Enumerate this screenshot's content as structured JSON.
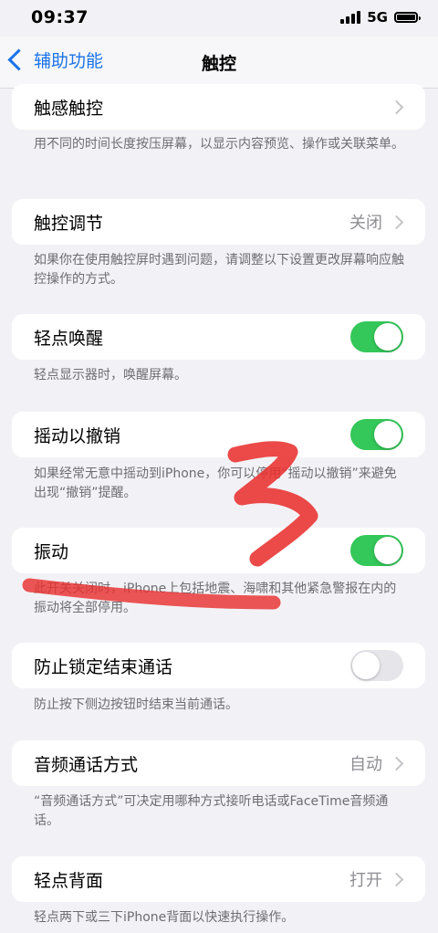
{
  "status_bar": {
    "time": "09:37",
    "network": "5G"
  },
  "nav": {
    "back_label": "辅助功能",
    "title": "触控"
  },
  "sections": [
    {
      "label": "触感触控",
      "value": "",
      "footnote": "用不同的时间长度按压屏幕，以显示内容预览、操作或关联菜单。"
    },
    {
      "label": "触控调节",
      "value": "关闭",
      "footnote": "如果你在使用触控屏时遇到问题，请调整以下设置更改屏幕响应触控操作的方式。"
    },
    {
      "label": "轻点唤醒",
      "toggle": true,
      "footnote": "轻点显示器时，唤醒屏幕。"
    },
    {
      "label": "摇动以撤销",
      "toggle": true,
      "footnote": "如果经常无意中摇动到iPhone，你可以停用“摇动以撤销”来避免出现“撤销”提醒。"
    },
    {
      "label": "振动",
      "toggle": true,
      "footnote": "此开关关闭时，iPhone上包括地震、海啸和其他紧急警报在内的振动将全部停用。"
    },
    {
      "label": "防止锁定结束通话",
      "toggle": false,
      "footnote": "防止按下侧边按钮时结束当前通话。"
    },
    {
      "label": "音频通话方式",
      "value": "自动",
      "footnote": "“音频通话方式”可决定用哪种方式接听电话或FaceTime音频通话。"
    },
    {
      "label": "轻点背面",
      "value": "打开",
      "footnote": "轻点两下或三下iPhone背面以快速执行操作。"
    }
  ],
  "colors": {
    "accent": "#1a73e8",
    "toggle_on": "#34c759",
    "toggle_off": "#e5e5ea",
    "annotation": "#e8312f"
  }
}
